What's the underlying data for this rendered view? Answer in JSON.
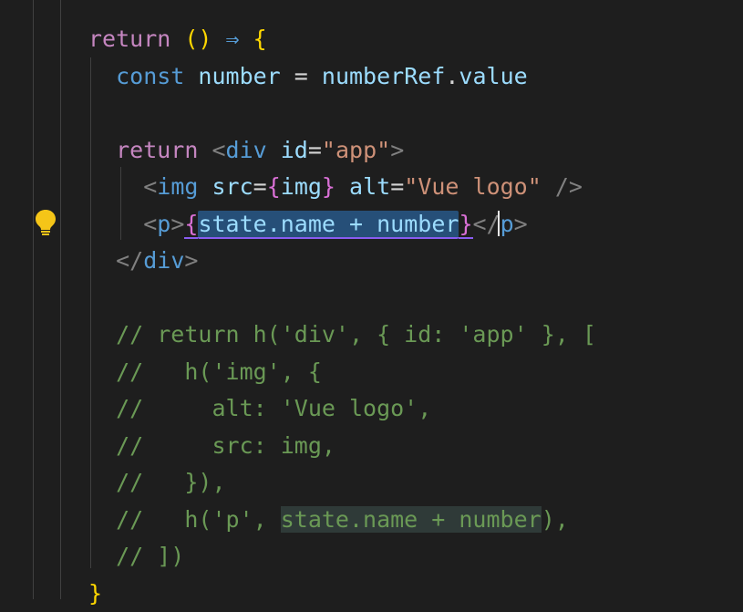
{
  "editor": {
    "lines": [
      {
        "tokens": [
          {
            "t": "return",
            "c": "kw"
          },
          {
            "t": " ",
            "c": ""
          },
          {
            "t": "()",
            "c": "brace"
          },
          {
            "t": " ",
            "c": ""
          },
          {
            "t": "⇒",
            "c": "tag"
          },
          {
            "t": " ",
            "c": ""
          },
          {
            "t": "{",
            "c": "brace"
          }
        ]
      },
      {
        "tokens": [
          {
            "t": "  const ",
            "c": "tag"
          },
          {
            "t": "number",
            "c": "var"
          },
          {
            "t": " = ",
            "c": ""
          },
          {
            "t": "numberRef",
            "c": "var"
          },
          {
            "t": ".",
            "c": ""
          },
          {
            "t": "value",
            "c": "prop"
          }
        ]
      },
      {
        "tokens": []
      },
      {
        "tokens": [
          {
            "t": "  return ",
            "c": "kw"
          },
          {
            "t": "<",
            "c": "punc"
          },
          {
            "t": "div",
            "c": "tag"
          },
          {
            "t": " ",
            "c": ""
          },
          {
            "t": "id",
            "c": "attr"
          },
          {
            "t": "=",
            "c": ""
          },
          {
            "t": "\"app\"",
            "c": "str"
          },
          {
            "t": ">",
            "c": "punc"
          }
        ]
      },
      {
        "tokens": [
          {
            "t": "    <",
            "c": "punc"
          },
          {
            "t": "img",
            "c": "tag"
          },
          {
            "t": " ",
            "c": ""
          },
          {
            "t": "src",
            "c": "attr"
          },
          {
            "t": "=",
            "c": ""
          },
          {
            "t": "{",
            "c": "brace2"
          },
          {
            "t": "img",
            "c": "var"
          },
          {
            "t": "}",
            "c": "brace2"
          },
          {
            "t": " ",
            "c": ""
          },
          {
            "t": "alt",
            "c": "attr"
          },
          {
            "t": "=",
            "c": ""
          },
          {
            "t": "\"Vue logo\"",
            "c": "str"
          },
          {
            "t": " />",
            "c": "punc"
          }
        ]
      },
      {
        "tokens": [
          {
            "t": "    <",
            "c": "punc"
          },
          {
            "t": "p",
            "c": "tag"
          },
          {
            "t": ">",
            "c": "punc"
          },
          {
            "t": "{",
            "c": "brace2 squiggle"
          },
          {
            "t": "state.name + number",
            "c": "var sel squiggle"
          },
          {
            "t": "}",
            "c": "brace2 squiggle"
          },
          {
            "t": "</",
            "c": "punc"
          },
          {
            "t": "p",
            "c": "tag"
          },
          {
            "t": ">",
            "c": "punc"
          }
        ]
      },
      {
        "tokens": [
          {
            "t": "  </",
            "c": "punc"
          },
          {
            "t": "div",
            "c": "tag"
          },
          {
            "t": ">",
            "c": "punc"
          }
        ]
      },
      {
        "tokens": []
      },
      {
        "tokens": [
          {
            "t": "  // return h('div', { id: 'app' }, [",
            "c": "cmt"
          }
        ]
      },
      {
        "tokens": [
          {
            "t": "  //   h('img', {",
            "c": "cmt"
          }
        ]
      },
      {
        "tokens": [
          {
            "t": "  //     alt: 'Vue logo',",
            "c": "cmt"
          }
        ]
      },
      {
        "tokens": [
          {
            "t": "  //     src: img,",
            "c": "cmt"
          }
        ]
      },
      {
        "tokens": [
          {
            "t": "  //   }),",
            "c": "cmt"
          }
        ]
      },
      {
        "tokens": [
          {
            "t": "  //   h('p', ",
            "c": "cmt"
          },
          {
            "t": "state.name + number",
            "c": "cmt hl"
          },
          {
            "t": "),",
            "c": "cmt"
          }
        ]
      },
      {
        "tokens": [
          {
            "t": "  // ])",
            "c": "cmt"
          }
        ]
      },
      {
        "tokens": [
          {
            "t": "}",
            "c": "brace"
          }
        ]
      }
    ]
  },
  "icons": {
    "lightbulb": "lightbulb-icon"
  }
}
